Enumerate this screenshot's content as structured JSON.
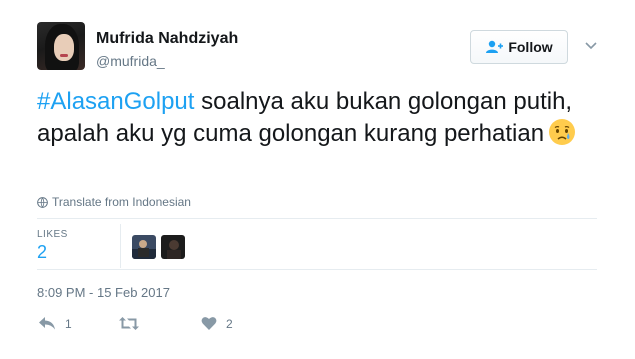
{
  "user": {
    "display_name": "Mufrida Nahdziyah",
    "screen_name": "@mufrida_"
  },
  "follow_button": {
    "label": "Follow"
  },
  "tweet": {
    "hashtag": "#AlasanGolput",
    "text": " soalnya aku bukan golongan putih, apalah aku yg cuma golongan kurang perhatian",
    "emoji": "crying-face-icon"
  },
  "translate": {
    "label": "Translate from Indonesian"
  },
  "stats": {
    "likes_label": "LIKES",
    "likes_count": "2"
  },
  "timestamp": "8:09 PM - 15 Feb 2017",
  "actions": {
    "reply_count": "1",
    "retweet_count": "",
    "like_count": "2"
  },
  "colors": {
    "accent": "#1da1f2",
    "muted": "#657786",
    "text": "#14171a"
  }
}
